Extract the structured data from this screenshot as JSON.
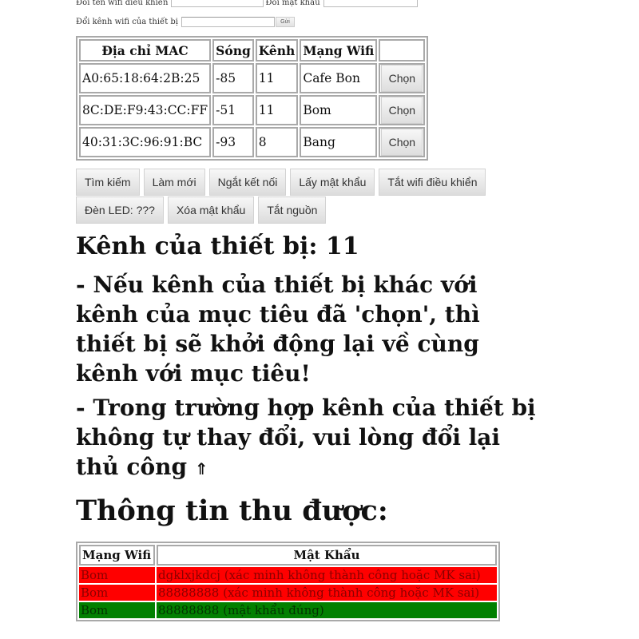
{
  "config": {
    "ssid_label": "Đổi tên wifi điều khiển",
    "ssid_value": "",
    "password_label": "Đổi mật khẩu",
    "password_value": "",
    "channel_label": "Đổi kênh wifi của thiết bị",
    "channel_value": "",
    "send_label": "Gửi"
  },
  "scan_table": {
    "headers": [
      "Địa chỉ MAC",
      "Sóng",
      "Kênh",
      "Mạng Wifi",
      ""
    ],
    "rows": [
      {
        "mac": "A0:65:18:64:2B:25",
        "signal": "-85",
        "channel": "11",
        "ssid": "Cafe Bon",
        "action": "Chọn"
      },
      {
        "mac": "8C:DE:F9:43:CC:FF",
        "signal": "-51",
        "channel": "11",
        "ssid": "Bom",
        "action": "Chọn"
      },
      {
        "mac": "40:31:3C:96:91:BC",
        "signal": "-93",
        "channel": "8",
        "ssid": "Bang",
        "action": "Chọn"
      }
    ]
  },
  "controls": [
    {
      "label": "Tìm kiếm"
    },
    {
      "label": "Làm mới"
    },
    {
      "label": "Ngắt kết nối"
    },
    {
      "label": "Lấy mật khẩu"
    },
    {
      "label": "Tắt wifi điều khiển"
    },
    {
      "label": "Đèn LED: ???"
    },
    {
      "label": "Xóa mật khẩu"
    },
    {
      "label": "Tắt nguồn"
    }
  ],
  "device_channel": "Kênh của thiết bị: 11",
  "notes": {
    "note1": "- Nếu kênh của thiết bị khác với kênh của mục tiêu đã 'chọn', thì thiết bị sẽ khởi động lại về cùng kênh với mục tiêu!",
    "note2": "- Trong trường hợp kênh của thiết bị không tự thay đổi, vui lòng đổi lại thủ công",
    "arrow_icon": "⇑"
  },
  "captured": {
    "title": "Thông tin thu được:",
    "headers": [
      "Mạng Wifi",
      "Mật Khẩu"
    ],
    "rows": [
      {
        "ssid": "Bom",
        "password": "dgklxjkdcj (xác minh không thành công hoặc MK sai)",
        "status": "fail"
      },
      {
        "ssid": "Bom",
        "password": "88888888 (xác minh không thành công hoặc MK sai)",
        "status": "fail"
      },
      {
        "ssid": "Bom",
        "password": "88888888 (mật khẩu đúng)",
        "status": "success"
      }
    ],
    "colors": {
      "fail": "#ff0000",
      "success": "#008000"
    }
  }
}
